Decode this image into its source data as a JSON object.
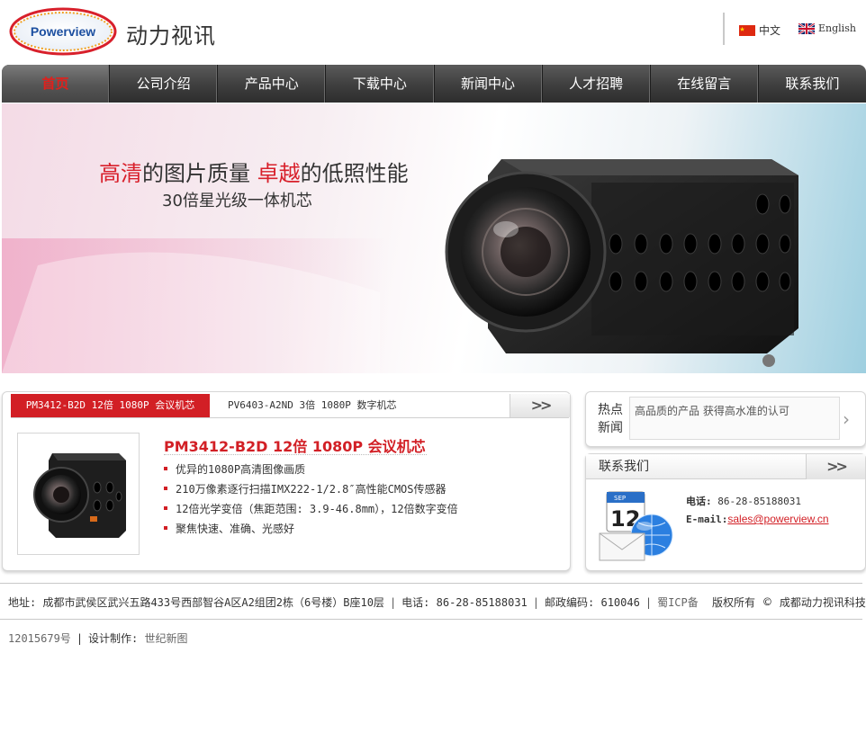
{
  "header": {
    "logo_text": "Powerview",
    "brand": "动力视讯",
    "lang_cn": "中文",
    "lang_en": "English"
  },
  "nav": {
    "items": [
      "首页",
      "公司介绍",
      "产品中心",
      "下载中心",
      "新闻中心",
      "人才招聘",
      "在线留言",
      "联系我们"
    ]
  },
  "banner": {
    "title_a": "高清",
    "title_b": "的图片质量 ",
    "title_c": "卓越",
    "title_d": "的低照性能",
    "subtitle": "30倍星光级一体机芯"
  },
  "products": {
    "tab_active": "PM3412-B2D 12倍 1080P 会议机芯",
    "tab_2": "PV6403-A2ND 3倍 1080P 数字机芯",
    "more": ">>",
    "title": "PM3412-B2D 12倍 1080P 会议机芯",
    "features": [
      "优异的1080P高清图像画质",
      "210万像素逐行扫描IMX222-1/2.8″高性能CMOS传感器",
      "12倍光学变倍（焦距范围: 3.9-46.8mm），12倍数字变倍",
      "聚焦快速、准确、光感好"
    ]
  },
  "hotnews": {
    "label": "热点新闻",
    "text": "高品质的产品 获得高水准的认可",
    "arrow": "›"
  },
  "contact": {
    "heading": "联系我们",
    "more": ">>",
    "phone_label": "电话:",
    "phone": "86-28-85188031",
    "email_label": "E-mail:",
    "email": "sales@powerview.cn",
    "calendar_month": "SEP",
    "calendar_day": "12"
  },
  "footer": {
    "address": "地址: 成都市武侯区武兴五路433号西部智谷A区A2组团2栋（6号楼）B座10层",
    "phone": "电话: 86-28-85188031",
    "postcode": "邮政编码: 610046",
    "icp": "蜀ICP备",
    "rights": "版权所有",
    "copyright_symbol": "©",
    "company": "成都动力视讯科技有限公司",
    "icp_number": "12015679号",
    "design_label": "设计制作:",
    "designer": "世纪新图"
  },
  "colors": {
    "accent_red": "#d21f25",
    "nav_dark": "#3e3e3e"
  }
}
